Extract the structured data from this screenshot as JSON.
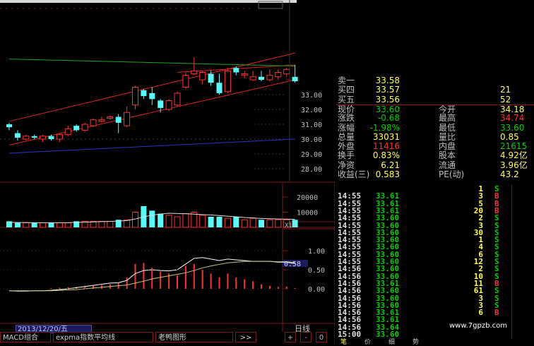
{
  "colors": {
    "up": "#ff3232",
    "down": "#54fcfc",
    "grid": "#7a1a1a",
    "label": "#c0c0c0",
    "channel": "#e02020",
    "ma_long": "#20a020",
    "ma_base": "#3030c0",
    "price_yellow": "#ffff54",
    "green": "#00d000",
    "red_text": "#ff3030"
  },
  "price_axis": {
    "labels": [
      "33.00",
      "32.00",
      "31.00",
      "30.00",
      "29.00",
      "28.00"
    ]
  },
  "volume_axis": {
    "labels": [
      "20000",
      "10000"
    ],
    "unit": "X10"
  },
  "macd_axis": {
    "labels": [
      "1.00",
      "0.50",
      "0.00"
    ],
    "marker": "0.58"
  },
  "quote": {
    "rows": [
      {
        "l1": "卖一",
        "v1": "33.58",
        "l2": "",
        "v2": ""
      },
      {
        "l1": "买四",
        "v1": "33.57",
        "l2": "",
        "v2": "21"
      },
      {
        "l1": "买五",
        "v1": "33.56",
        "l2": "",
        "v2": "52"
      },
      {
        "l1": "现价",
        "v1": "33.60",
        "l2": "今开",
        "v2": "34.18"
      },
      {
        "l1": "涨跌",
        "v1": "-0.68",
        "l2": "最高",
        "v2": "34.74"
      },
      {
        "l1": "涨幅",
        "v1": "-1.98%",
        "l2": "最低",
        "v2": "33.60"
      },
      {
        "l1": "总量",
        "v1": "33031",
        "l2": "量比",
        "v2": "0.85"
      },
      {
        "l1": "外盘",
        "v1": "11416",
        "l2": "内盘",
        "v2": "21615"
      },
      {
        "l1": "换手",
        "v1": "0.83%",
        "l2": "股本",
        "v2": "4.92亿"
      },
      {
        "l1": "净资",
        "v1": "6.21",
        "l2": "流通",
        "v2": "3.96亿"
      },
      {
        "l1": "收益(三)",
        "v1": "0.583",
        "l2": "PE(动)",
        "v2": "43.2"
      }
    ]
  },
  "ticks": [
    {
      "t": "",
      "p": "",
      "v": "1",
      "f": "S"
    },
    {
      "t": "14:55",
      "p": "33.61",
      "v": "3",
      "f": "B"
    },
    {
      "t": "14:55",
      "p": "33.61",
      "v": "5",
      "f": "B"
    },
    {
      "t": "14:55",
      "p": "33.61",
      "v": "20",
      "f": "B"
    },
    {
      "t": "14:55",
      "p": "33.60",
      "v": "2",
      "f": "S"
    },
    {
      "t": "14:55",
      "p": "33.60",
      "v": "3",
      "f": "S"
    },
    {
      "t": "14:55",
      "p": "33.60",
      "v": "30",
      "f": "S"
    },
    {
      "t": "14:55",
      "p": "33.60",
      "v": "1",
      "f": "S"
    },
    {
      "t": "14:55",
      "p": "33.60",
      "v": "4",
      "f": "S"
    },
    {
      "t": "14:55",
      "p": "33.60",
      "v": "6",
      "f": "S"
    },
    {
      "t": "14:55",
      "p": "33.60",
      "v": "12",
      "f": "S"
    },
    {
      "t": "14:56",
      "p": "33.60",
      "v": "2",
      "f": "S"
    },
    {
      "t": "14:56",
      "p": "33.60",
      "v": "10",
      "f": "S"
    },
    {
      "t": "14:56",
      "p": "33.61",
      "v": "11",
      "f": "B"
    },
    {
      "t": "14:56",
      "p": "33.60",
      "v": "61",
      "f": "S"
    },
    {
      "t": "14:56",
      "p": "33.60",
      "v": "3",
      "f": "S"
    },
    {
      "t": "14:56",
      "p": "33.60",
      "v": "3",
      "f": "S"
    },
    {
      "t": "14:56",
      "p": "33.61",
      "v": "6",
      "f": "B"
    },
    {
      "t": "14:56",
      "p": "33.61",
      "v": "",
      "f": ""
    },
    {
      "t": "14:56",
      "p": "33.64",
      "v": "",
      "f": ""
    },
    {
      "t": "15:00",
      "p": "33.60",
      "v": "",
      "f": ""
    }
  ],
  "date_box": "2013/12/20/五",
  "period": "日线",
  "bottom_tabs": [
    "MACD组合",
    "expma指数平均线",
    "老鸭图形",
    ">>"
  ],
  "nav": [
    "+",
    "-",
    "0"
  ],
  "right_tabs": [
    "笔",
    "价",
    "细",
    "势"
  ],
  "watermark": "www.7gpzb.com",
  "candles": [
    {
      "o": 31.0,
      "c": 30.8,
      "h": 31.1,
      "l": 30.6
    },
    {
      "o": 30.4,
      "c": 30.1,
      "h": 30.6,
      "l": 29.9
    },
    {
      "o": 30.0,
      "c": 30.2,
      "h": 30.3,
      "l": 29.9
    },
    {
      "o": 30.2,
      "c": 30.1,
      "h": 30.3,
      "l": 30.0
    },
    {
      "o": 30.0,
      "c": 30.2,
      "h": 30.3,
      "l": 29.8
    },
    {
      "o": 30.2,
      "c": 30.0,
      "h": 30.3,
      "l": 29.9
    },
    {
      "o": 30.0,
      "c": 30.3,
      "h": 30.4,
      "l": 29.8
    },
    {
      "o": 30.3,
      "c": 30.7,
      "h": 30.9,
      "l": 30.2
    },
    {
      "o": 30.9,
      "c": 30.6,
      "h": 31.0,
      "l": 30.5
    },
    {
      "o": 30.6,
      "c": 31.0,
      "h": 31.1,
      "l": 30.5
    },
    {
      "o": 30.9,
      "c": 31.3,
      "h": 31.4,
      "l": 30.8
    },
    {
      "o": 31.2,
      "c": 31.3,
      "h": 31.5,
      "l": 31.1
    },
    {
      "o": 31.4,
      "c": 31.5,
      "h": 31.6,
      "l": 31.3
    },
    {
      "o": 31.5,
      "c": 31.1,
      "h": 31.7,
      "l": 30.4
    },
    {
      "o": 30.9,
      "c": 31.8,
      "h": 32.2,
      "l": 30.8
    },
    {
      "o": 32.3,
      "c": 33.5,
      "h": 33.6,
      "l": 32.0
    },
    {
      "o": 33.3,
      "c": 32.9,
      "h": 33.4,
      "l": 32.7
    },
    {
      "o": 33.1,
      "c": 32.7,
      "h": 33.5,
      "l": 32.3
    },
    {
      "o": 32.6,
      "c": 32.1,
      "h": 32.7,
      "l": 31.8
    },
    {
      "o": 32.0,
      "c": 32.6,
      "h": 32.7,
      "l": 31.9
    },
    {
      "o": 32.3,
      "c": 33.1,
      "h": 33.2,
      "l": 32.2
    },
    {
      "o": 33.5,
      "c": 34.3,
      "h": 34.5,
      "l": 33.4
    },
    {
      "o": 34.4,
      "c": 34.6,
      "h": 35.5,
      "l": 34.3
    },
    {
      "o": 34.0,
      "c": 34.5,
      "h": 34.6,
      "l": 33.7
    },
    {
      "o": 34.4,
      "c": 33.8,
      "h": 34.6,
      "l": 33.6
    },
    {
      "o": 33.8,
      "c": 33.1,
      "h": 34.4,
      "l": 33.0
    },
    {
      "o": 33.2,
      "c": 34.6,
      "h": 34.8,
      "l": 33.1
    },
    {
      "o": 34.8,
      "c": 34.5,
      "h": 34.9,
      "l": 34.3
    },
    {
      "o": 34.3,
      "c": 34.4,
      "h": 34.6,
      "l": 34.1
    },
    {
      "o": 34.0,
      "c": 34.2,
      "h": 34.6,
      "l": 33.9
    },
    {
      "o": 34.2,
      "c": 34.0,
      "h": 34.6,
      "l": 33.9
    },
    {
      "o": 34.0,
      "c": 34.3,
      "h": 34.7,
      "l": 33.9
    },
    {
      "o": 34.2,
      "c": 34.5,
      "h": 34.7,
      "l": 34.0
    },
    {
      "o": 34.4,
      "c": 34.7,
      "h": 34.8,
      "l": 34.2
    },
    {
      "o": 34.2,
      "c": 33.9,
      "h": 35.0,
      "l": 33.8
    }
  ],
  "volume": [
    4,
    3,
    3,
    3,
    3,
    3,
    3,
    3,
    4,
    4,
    4,
    4,
    4,
    5,
    5,
    10,
    14,
    11,
    9,
    8,
    7,
    9,
    10,
    8,
    7,
    7,
    6,
    7,
    5,
    6,
    5,
    5,
    5,
    5,
    5
  ],
  "vol_ma": [
    3.3,
    3.2,
    3.2,
    3.1,
    3.1,
    3.1,
    3.1,
    3.1,
    3.3,
    3.4,
    3.6,
    3.8,
    3.9,
    4.2,
    4.5,
    5.5,
    6.9,
    8.0,
    8.8,
    9.3,
    9.1,
    9.0,
    8.7,
    8.4,
    8.2,
    7.8,
    7.3,
    7.0,
    6.5,
    6.2,
    5.9,
    5.7,
    5.5,
    5.4,
    5.3
  ],
  "macd_hist": [
    0.0,
    0.0,
    0.0,
    0.0,
    0.0,
    0.02,
    0.03,
    0.04,
    0.05,
    0.06,
    0.08,
    0.1,
    0.12,
    0.15,
    0.3,
    0.65,
    0.68,
    0.55,
    0.45,
    0.4,
    0.35,
    0.6,
    0.65,
    0.5,
    0.4,
    0.3,
    0.4,
    0.3,
    0.25,
    0.2,
    0.12,
    0.08,
    0.05,
    0.06,
    0.02
  ],
  "macd_dif": [
    -0.05,
    -0.06,
    -0.06,
    -0.05,
    -0.05,
    -0.04,
    -0.02,
    0.0,
    0.03,
    0.06,
    0.09,
    0.12,
    0.15,
    0.16,
    0.22,
    0.4,
    0.48,
    0.5,
    0.48,
    0.47,
    0.5,
    0.65,
    0.8,
    0.82,
    0.78,
    0.74,
    0.78,
    0.76,
    0.74,
    0.72,
    0.72,
    0.72,
    0.7,
    0.7,
    0.66
  ],
  "macd_dea": [
    -0.05,
    -0.05,
    -0.05,
    -0.05,
    -0.05,
    -0.05,
    -0.04,
    -0.03,
    -0.02,
    0.0,
    0.02,
    0.04,
    0.06,
    0.08,
    0.1,
    0.15,
    0.2,
    0.26,
    0.3,
    0.34,
    0.38,
    0.42,
    0.48,
    0.55,
    0.6,
    0.64,
    0.68,
    0.7,
    0.72,
    0.72,
    0.72,
    0.72,
    0.71,
    0.71,
    0.69
  ]
}
